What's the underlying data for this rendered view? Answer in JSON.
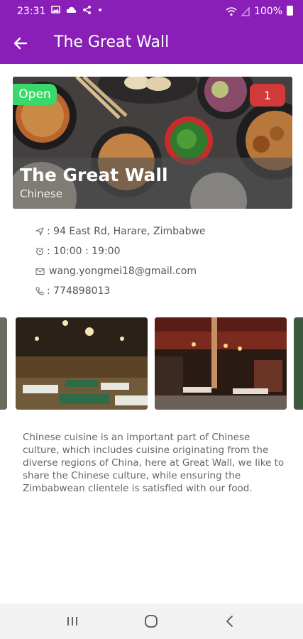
{
  "status_bar": {
    "time": "23:31",
    "battery": "100%",
    "icons_left": [
      "image-icon",
      "cloud-icon",
      "share-icon",
      "dot-icon"
    ],
    "icons_right": [
      "wifi-icon",
      "signal-icon",
      "battery-icon"
    ]
  },
  "app_bar": {
    "title": "The Great Wall",
    "back_icon": "arrow-left-icon",
    "background_color": "#8a1fb8"
  },
  "hero": {
    "name": "The Great Wall",
    "cuisine": "Chinese",
    "status": "Open",
    "status_color": "#39d86b",
    "badge_count": "1",
    "badge_color": "#d23a3a"
  },
  "info": {
    "address": ": 94 East Rd, Harare, Zimbabwe",
    "hours": ": 10:00 : 19:00",
    "email": "wang.yongmei18@gmail.com",
    "phone": ": 774898013",
    "address_icon": "navigation-icon",
    "hours_icon": "alarm-clock-icon",
    "email_icon": "envelope-icon",
    "phone_icon": "phone-icon"
  },
  "gallery": {
    "images": [
      "restaurant-interior-photo-1",
      "restaurant-interior-photo-2"
    ]
  },
  "description": "Chinese cuisine is an important part of Chinese\nculture, which includes cuisine originating from the\ndiverse regions of China, here at Great Wall, we like to\nshare the Chinese culture, while ensuring the\nZimbabwean clientele is satisfied with our food.",
  "nav_bar": {
    "icons": [
      "recent-apps-icon",
      "home-icon",
      "back-icon"
    ]
  }
}
